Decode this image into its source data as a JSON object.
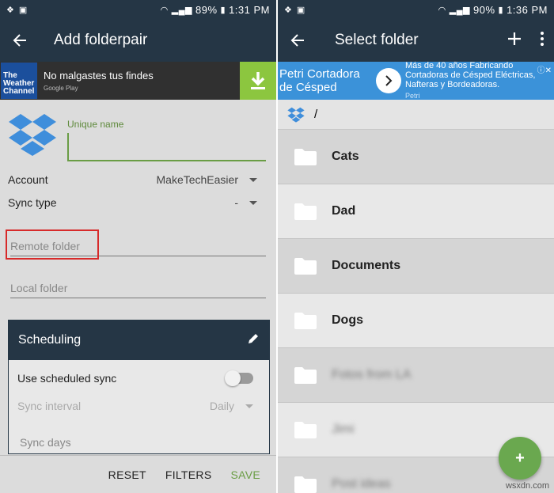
{
  "left": {
    "status": {
      "percent": "89%",
      "time": "1:31 PM"
    },
    "appbar": {
      "title": "Add folderpair"
    },
    "ad": {
      "logo_text": "The Weather Channel",
      "title": "No malgastes tus findes",
      "sub": "Google Play"
    },
    "form": {
      "unique_name_label": "Unique name",
      "account_label": "Account",
      "account_value": "MakeTechEasier",
      "sync_type_label": "Sync type",
      "sync_type_value": "-",
      "remote_folder_placeholder": "Remote folder",
      "local_folder_placeholder": "Local folder"
    },
    "scheduling": {
      "title": "Scheduling",
      "use_scheduled_label": "Use scheduled sync",
      "sync_interval_label": "Sync interval",
      "sync_interval_value": "Daily",
      "sync_days_label": "Sync days"
    },
    "bottom": {
      "reset": "RESET",
      "filters": "FILTERS",
      "save": "SAVE"
    }
  },
  "right": {
    "status": {
      "percent": "90%",
      "time": "1:36 PM"
    },
    "appbar": {
      "title": "Select  folder"
    },
    "ad": {
      "headline": "Petri Cortadora de Césped",
      "desc": "Más de 40 años Fabricando Cortadoras de Césped Eléctricas, Nafteras y Bordeadoras.",
      "brand": "Petri"
    },
    "path": "/",
    "folders": [
      {
        "name": "Cats"
      },
      {
        "name": "Dad"
      },
      {
        "name": "Documents"
      },
      {
        "name": "Dogs"
      },
      {
        "name": "Fotos from LA"
      },
      {
        "name": "Jimi"
      },
      {
        "name": "Post ideas"
      }
    ],
    "fab": "+"
  },
  "watermark": "wsxdn.com",
  "colors": {
    "primary": "#253645",
    "accent": "#6a9d45",
    "highlight": "#d72a2a",
    "ad_blue": "#3b92d9"
  }
}
